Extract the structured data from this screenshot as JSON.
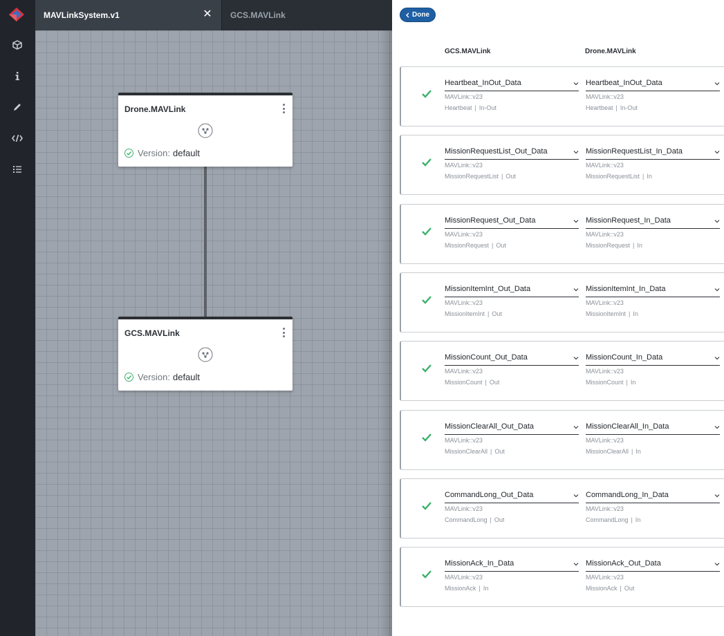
{
  "tabs": [
    {
      "label": "MAVLinkSystem.v1",
      "active": true
    },
    {
      "label": "GCS.MAVLink",
      "active": false
    }
  ],
  "rail_icons": [
    "cube-icon",
    "info-icon",
    "pencil-icon",
    "code-icon",
    "checklist-icon"
  ],
  "canvas": {
    "nodes": [
      {
        "title": "Drone.MAVLink",
        "version_label": "Version:",
        "version_value": "default"
      },
      {
        "title": "GCS.MAVLink",
        "version_label": "Version:",
        "version_value": "default"
      }
    ]
  },
  "panel": {
    "done_label": "Done",
    "col_left": "GCS.MAVLink",
    "col_right": "Drone.MAVLink",
    "rows": [
      {
        "left": {
          "sel": "Heartbeat_InOut_Data",
          "meta1": "MAVLink::v23",
          "meta_msg": "Heartbeat",
          "meta_dir": "In-Out"
        },
        "right": {
          "sel": "Heartbeat_InOut_Data",
          "meta1": "MAVLink::v23",
          "meta_msg": "Heartbeat",
          "meta_dir": "In-Out"
        }
      },
      {
        "left": {
          "sel": "MissionRequestList_Out_Data",
          "meta1": "MAVLink::v23",
          "meta_msg": "MissionRequestList",
          "meta_dir": "Out"
        },
        "right": {
          "sel": "MissionRequestList_In_Data",
          "meta1": "MAVLink::v23",
          "meta_msg": "MissionRequestList",
          "meta_dir": "In"
        }
      },
      {
        "left": {
          "sel": "MissionRequest_Out_Data",
          "meta1": "MAVLink::v23",
          "meta_msg": "MissionRequest",
          "meta_dir": "Out"
        },
        "right": {
          "sel": "MissionRequest_In_Data",
          "meta1": "MAVLink::v23",
          "meta_msg": "MissionRequest",
          "meta_dir": "In"
        }
      },
      {
        "left": {
          "sel": "MissionItemInt_Out_Data",
          "meta1": "MAVLink::v23",
          "meta_msg": "MissionItemInt",
          "meta_dir": "Out"
        },
        "right": {
          "sel": "MissionItemInt_In_Data",
          "meta1": "MAVLink::v23",
          "meta_msg": "MissionItemInt",
          "meta_dir": "In"
        }
      },
      {
        "left": {
          "sel": "MissionCount_Out_Data",
          "meta1": "MAVLink::v23",
          "meta_msg": "MissionCount",
          "meta_dir": "Out"
        },
        "right": {
          "sel": "MissionCount_In_Data",
          "meta1": "MAVLink::v23",
          "meta_msg": "MissionCount",
          "meta_dir": "In"
        }
      },
      {
        "left": {
          "sel": "MissionClearAll_Out_Data",
          "meta1": "MAVLink::v23",
          "meta_msg": "MissionClearAll",
          "meta_dir": "Out"
        },
        "right": {
          "sel": "MissionClearAll_In_Data",
          "meta1": "MAVLink::v23",
          "meta_msg": "MissionClearAll",
          "meta_dir": "In"
        }
      },
      {
        "left": {
          "sel": "CommandLong_Out_Data",
          "meta1": "MAVLink::v23",
          "meta_msg": "CommandLong",
          "meta_dir": "Out"
        },
        "right": {
          "sel": "CommandLong_In_Data",
          "meta1": "MAVLink::v23",
          "meta_msg": "CommandLong",
          "meta_dir": "In"
        }
      },
      {
        "left": {
          "sel": "MissionAck_In_Data",
          "meta1": "MAVLink::v23",
          "meta_msg": "MissionAck",
          "meta_dir": "In"
        },
        "right": {
          "sel": "MissionAck_Out_Data",
          "meta1": "MAVLink::v23",
          "meta_msg": "MissionAck",
          "meta_dir": "Out"
        }
      }
    ]
  },
  "colors": {
    "rail_bg": "#21252b",
    "accent": "#1f5fa3",
    "check": "#3bb06b",
    "logo_red": "#d9333f",
    "logo_blue": "#3b6fc4"
  }
}
